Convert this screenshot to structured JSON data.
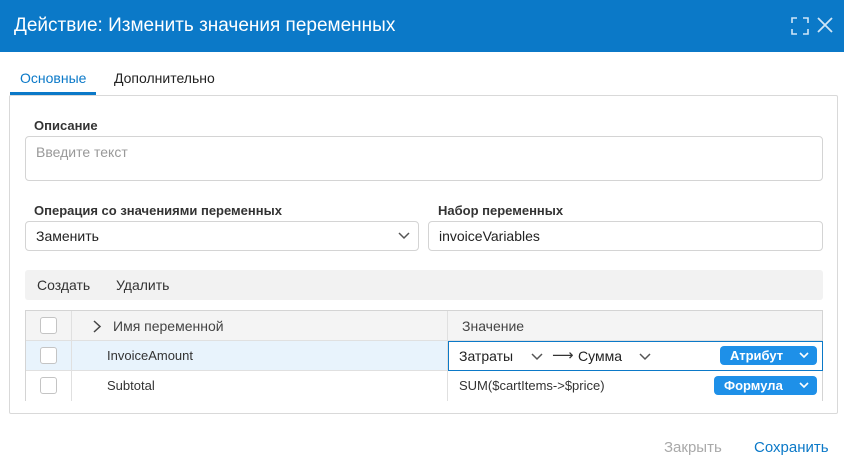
{
  "dialog": {
    "title": "Действие: Изменить значения переменных"
  },
  "tabs": [
    {
      "label": "Основные",
      "active": true
    },
    {
      "label": "Дополнительно",
      "active": false
    }
  ],
  "form": {
    "description_label": "Описание",
    "description_placeholder": "Введите текст",
    "description_value": "",
    "operation_label": "Операция со значениями переменных",
    "operation_value": "Заменить",
    "variable_set_label": "Набор переменных",
    "variable_set_value": "invoiceVariables"
  },
  "toolbar": {
    "create_label": "Создать",
    "delete_label": "Удалить"
  },
  "grid": {
    "columns": [
      "Имя переменной",
      "Значение"
    ],
    "rows": [
      {
        "name": "InvoiceAmount",
        "value_source": "Затраты",
        "value_target": "Сумма",
        "value_type": "Атрибут",
        "selected": true
      },
      {
        "name": "Subtotal",
        "value_formula": "SUM($cartItems->$price)",
        "value_type": "Формула",
        "selected": false
      }
    ]
  },
  "footer": {
    "close_label": "Закрыть",
    "save_label": "Сохранить"
  },
  "icons": {
    "maximize": "maximize-icon",
    "close": "close-icon",
    "chevron_down": "chevron-down-icon",
    "chevron_right": "chevron-right-icon",
    "arrow_right": "arrow-right-icon"
  },
  "colors": {
    "accent": "#0b79c8",
    "pill": "#1e90e8",
    "row_selected": "#e8f3fc",
    "disabled_text": "#a9a9a9"
  }
}
